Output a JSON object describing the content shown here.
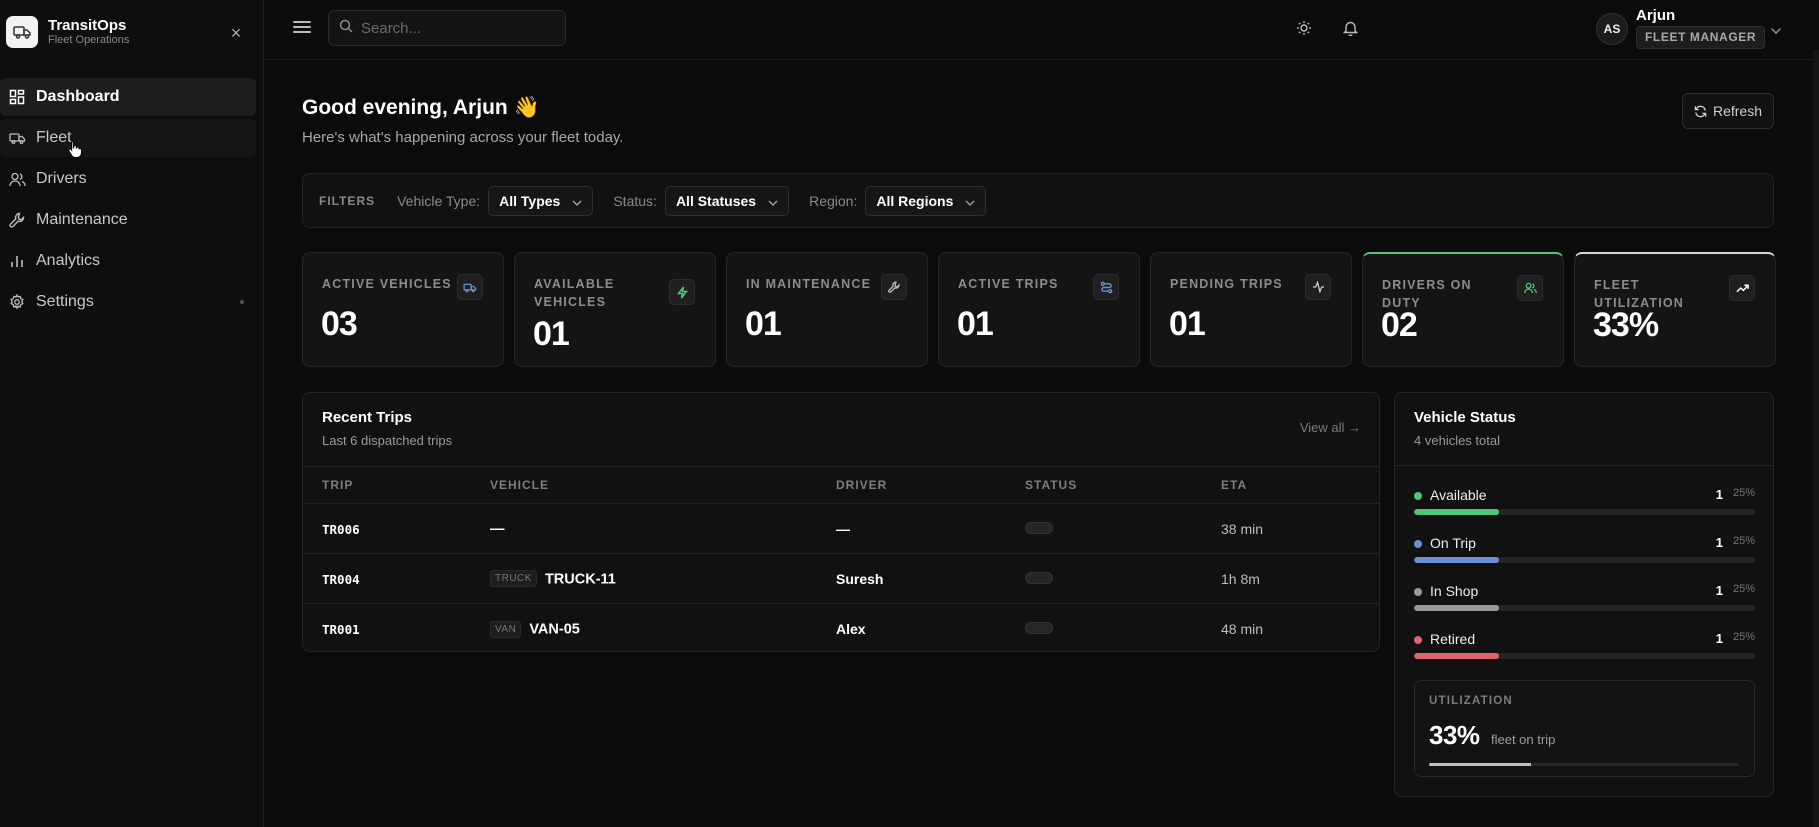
{
  "brand": {
    "name": "TransitOps",
    "subtitle": "Fleet Operations"
  },
  "sidebar": {
    "items": [
      {
        "label": "Dashboard",
        "icon": "grid-icon",
        "active": true
      },
      {
        "label": "Fleet",
        "icon": "truck-icon",
        "active": false
      },
      {
        "label": "Drivers",
        "icon": "users-icon",
        "active": false
      },
      {
        "label": "Maintenance",
        "icon": "wrench-icon",
        "active": false
      },
      {
        "label": "Analytics",
        "icon": "bar-chart-icon",
        "active": false
      },
      {
        "label": "Settings",
        "icon": "gear-icon",
        "active": false
      }
    ]
  },
  "topbar": {
    "search_placeholder": "Search...",
    "user": {
      "initials": "AS",
      "name": "Arjun",
      "role": "FLEET MANAGER"
    }
  },
  "header": {
    "greeting": "Good evening, Arjun 👋",
    "subtitle": "Here's what's happening across your fleet today.",
    "refresh_label": "Refresh"
  },
  "filters": {
    "title": "FILTERS",
    "vehicle_type": {
      "label": "Vehicle Type:",
      "value": "All Types"
    },
    "status": {
      "label": "Status:",
      "value": "All Statuses"
    },
    "region": {
      "label": "Region:",
      "value": "All Regions"
    }
  },
  "stats": [
    {
      "label": "ACTIVE VEHICLES",
      "value": "03",
      "icon": "truck-icon",
      "icon_color": "#6b8fd6"
    },
    {
      "label": "AVAILABLE VEHICLES",
      "value": "01",
      "icon": "bolt-icon",
      "icon_color": "#4fc779"
    },
    {
      "label": "IN MAINTENANCE",
      "value": "01",
      "icon": "wrench-icon",
      "icon_color": "#bbbbbb"
    },
    {
      "label": "ACTIVE TRIPS",
      "value": "01",
      "icon": "route-icon",
      "icon_color": "#6b8fd6"
    },
    {
      "label": "PENDING TRIPS",
      "value": "01",
      "icon": "activity-icon",
      "icon_color": "#cccccc"
    },
    {
      "label": "DRIVERS ON DUTY",
      "value": "02",
      "icon": "users-icon",
      "icon_color": "#4fc779"
    },
    {
      "label": "FLEET UTILIZATION",
      "value": "33%",
      "icon": "trend-up-icon",
      "icon_color": "#ffffff"
    }
  ],
  "recent_trips": {
    "title": "Recent Trips",
    "subtitle": "Last 6 dispatched trips",
    "view_all": "View all →",
    "columns": [
      "TRIP",
      "VEHICLE",
      "DRIVER",
      "STATUS",
      "ETA"
    ],
    "rows": [
      {
        "trip": "TR006",
        "vehicle_type": "",
        "vehicle": "—",
        "driver": "—",
        "eta": "38 min"
      },
      {
        "trip": "TR004",
        "vehicle_type": "TRUCK",
        "vehicle": "TRUCK-11",
        "driver": "Suresh",
        "eta": "1h 8m"
      },
      {
        "trip": "TR001",
        "vehicle_type": "VAN",
        "vehicle": "VAN-05",
        "driver": "Alex",
        "eta": "48 min"
      }
    ]
  },
  "vehicle_status": {
    "title": "Vehicle Status",
    "subtitle": "4 vehicles total",
    "items": [
      {
        "label": "Available",
        "count": "1",
        "pct": "25%",
        "fraction": 0.25,
        "color": "#4fc779"
      },
      {
        "label": "On Trip",
        "count": "1",
        "pct": "25%",
        "fraction": 0.25,
        "color": "#6b8fd6"
      },
      {
        "label": "In Shop",
        "count": "1",
        "pct": "25%",
        "fraction": 0.25,
        "color": "#9a9a9a"
      },
      {
        "label": "Retired",
        "count": "1",
        "pct": "25%",
        "fraction": 0.25,
        "color": "#e0626c"
      }
    ],
    "utilization": {
      "label": "UTILIZATION",
      "value": "33%",
      "sub": "fleet on trip",
      "fraction": 0.33
    }
  }
}
